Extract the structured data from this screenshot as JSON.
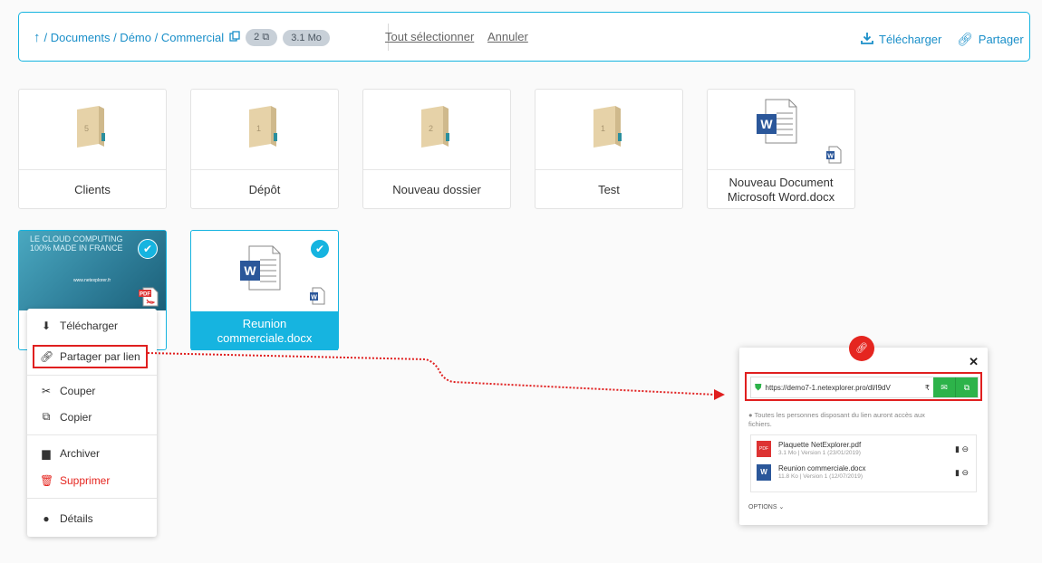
{
  "toolbar": {
    "up_arrow": "↑",
    "path": "/ Documents / Démo / Commercial",
    "count": "2",
    "size": "3.1 Mo",
    "select_all": "Tout sélectionner",
    "cancel": "Annuler",
    "download": "Télécharger",
    "share": "Partager"
  },
  "items": [
    {
      "name": "Clients",
      "type": "folder",
      "count": "5"
    },
    {
      "name": "Dépôt",
      "type": "folder",
      "count": "1"
    },
    {
      "name": "Nouveau dossier",
      "type": "folder",
      "count": "2"
    },
    {
      "name": "Test",
      "type": "folder",
      "count": "1"
    },
    {
      "name": "Nouveau Document Microsoft Word.docx",
      "type": "docx"
    },
    {
      "name": "Plaquette NetExplorer.pdf",
      "type": "pdf",
      "selected": true,
      "thumb_text": [
        "LE CLOUD COMPUTING",
        "100% MADE IN FRANCE",
        "www.netexplorer.fr"
      ]
    },
    {
      "name": "Reunion commerciale.docx",
      "type": "docx",
      "selected": true
    }
  ],
  "context_menu": {
    "download": "Télécharger",
    "share_link": "Partager par lien",
    "cut": "Couper",
    "copy": "Copier",
    "archive": "Archiver",
    "delete": "Supprimer",
    "details": "Détails"
  },
  "share_popup": {
    "url": "https://demo7-1.netexplorer.pro/dl/I9dV",
    "info": "Toutes les personnes disposant du lien auront accès aux fichiers.",
    "files": [
      {
        "name": "Plaquette NetExplorer.pdf",
        "meta": "3.1 Mo | Version 1 (23/01/2019)"
      },
      {
        "name": "Reunion commerciale.docx",
        "meta": "11.8 Ko | Version 1 (12/07/2019)"
      }
    ],
    "options": "OPTIONS"
  },
  "colors": {
    "accent": "#16b4e0",
    "link": "#1a8fc9",
    "danger": "#e52620",
    "success": "#2db34a"
  }
}
